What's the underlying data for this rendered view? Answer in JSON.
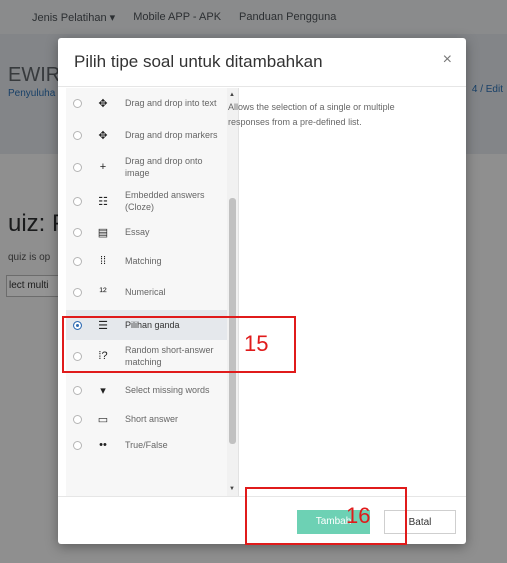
{
  "nav": {
    "items": [
      "Jenis Pelatihan ▾",
      "Mobile APP - APK",
      "Panduan Pengguna"
    ]
  },
  "background": {
    "site_title": "EWIRA",
    "site_sub": "Penyuluha",
    "crumb": "4 / Edit",
    "heading": "uiz: P",
    "small": "quiz is op",
    "select": "lect multi"
  },
  "modal": {
    "title": "Pilih tipe soal untuk ditambahkan",
    "close": "×",
    "description": "Allows the selection of a single or multiple responses from a pre-defined list.",
    "types": [
      {
        "label": "Drag and drop into text",
        "icon": "drag-drop-text-icon",
        "glyph": "✥",
        "selected": false
      },
      {
        "label": "Drag and drop markers",
        "icon": "drag-drop-markers-icon",
        "glyph": "✥",
        "selected": false
      },
      {
        "label": "Drag and drop onto image",
        "icon": "crosshair-icon",
        "glyph": "+",
        "selected": false
      },
      {
        "label": "Embedded answers (Cloze)",
        "icon": "cloze-icon",
        "glyph": "☷",
        "selected": false
      },
      {
        "label": "Essay",
        "icon": "essay-icon",
        "glyph": "▤",
        "selected": false
      },
      {
        "label": "Matching",
        "icon": "matching-icon",
        "glyph": "⁞⁞",
        "selected": false
      },
      {
        "label": "Numerical",
        "icon": "numerical-icon",
        "glyph": "¹²",
        "selected": false
      },
      {
        "label": "Pilihan ganda",
        "icon": "multichoice-icon",
        "glyph": "☰",
        "selected": true
      },
      {
        "label": "Random short-answer matching",
        "icon": "random-match-icon",
        "glyph": "⁞?",
        "selected": false
      },
      {
        "label": "Select missing words",
        "icon": "dropdown-icon",
        "glyph": "▾",
        "selected": false
      },
      {
        "label": "Short answer",
        "icon": "short-answer-icon",
        "glyph": "▭",
        "selected": false
      },
      {
        "label": "True/False",
        "icon": "truefalse-icon",
        "glyph": "••",
        "selected": false
      }
    ],
    "add_label": "Tambah",
    "cancel_label": "Batal"
  },
  "annotations": {
    "step_select": "15",
    "step_add": "16"
  },
  "colors": {
    "primary": "#6dd1b4",
    "annotation": "#e01b1b",
    "radio_selected": "#2f6bb3"
  }
}
